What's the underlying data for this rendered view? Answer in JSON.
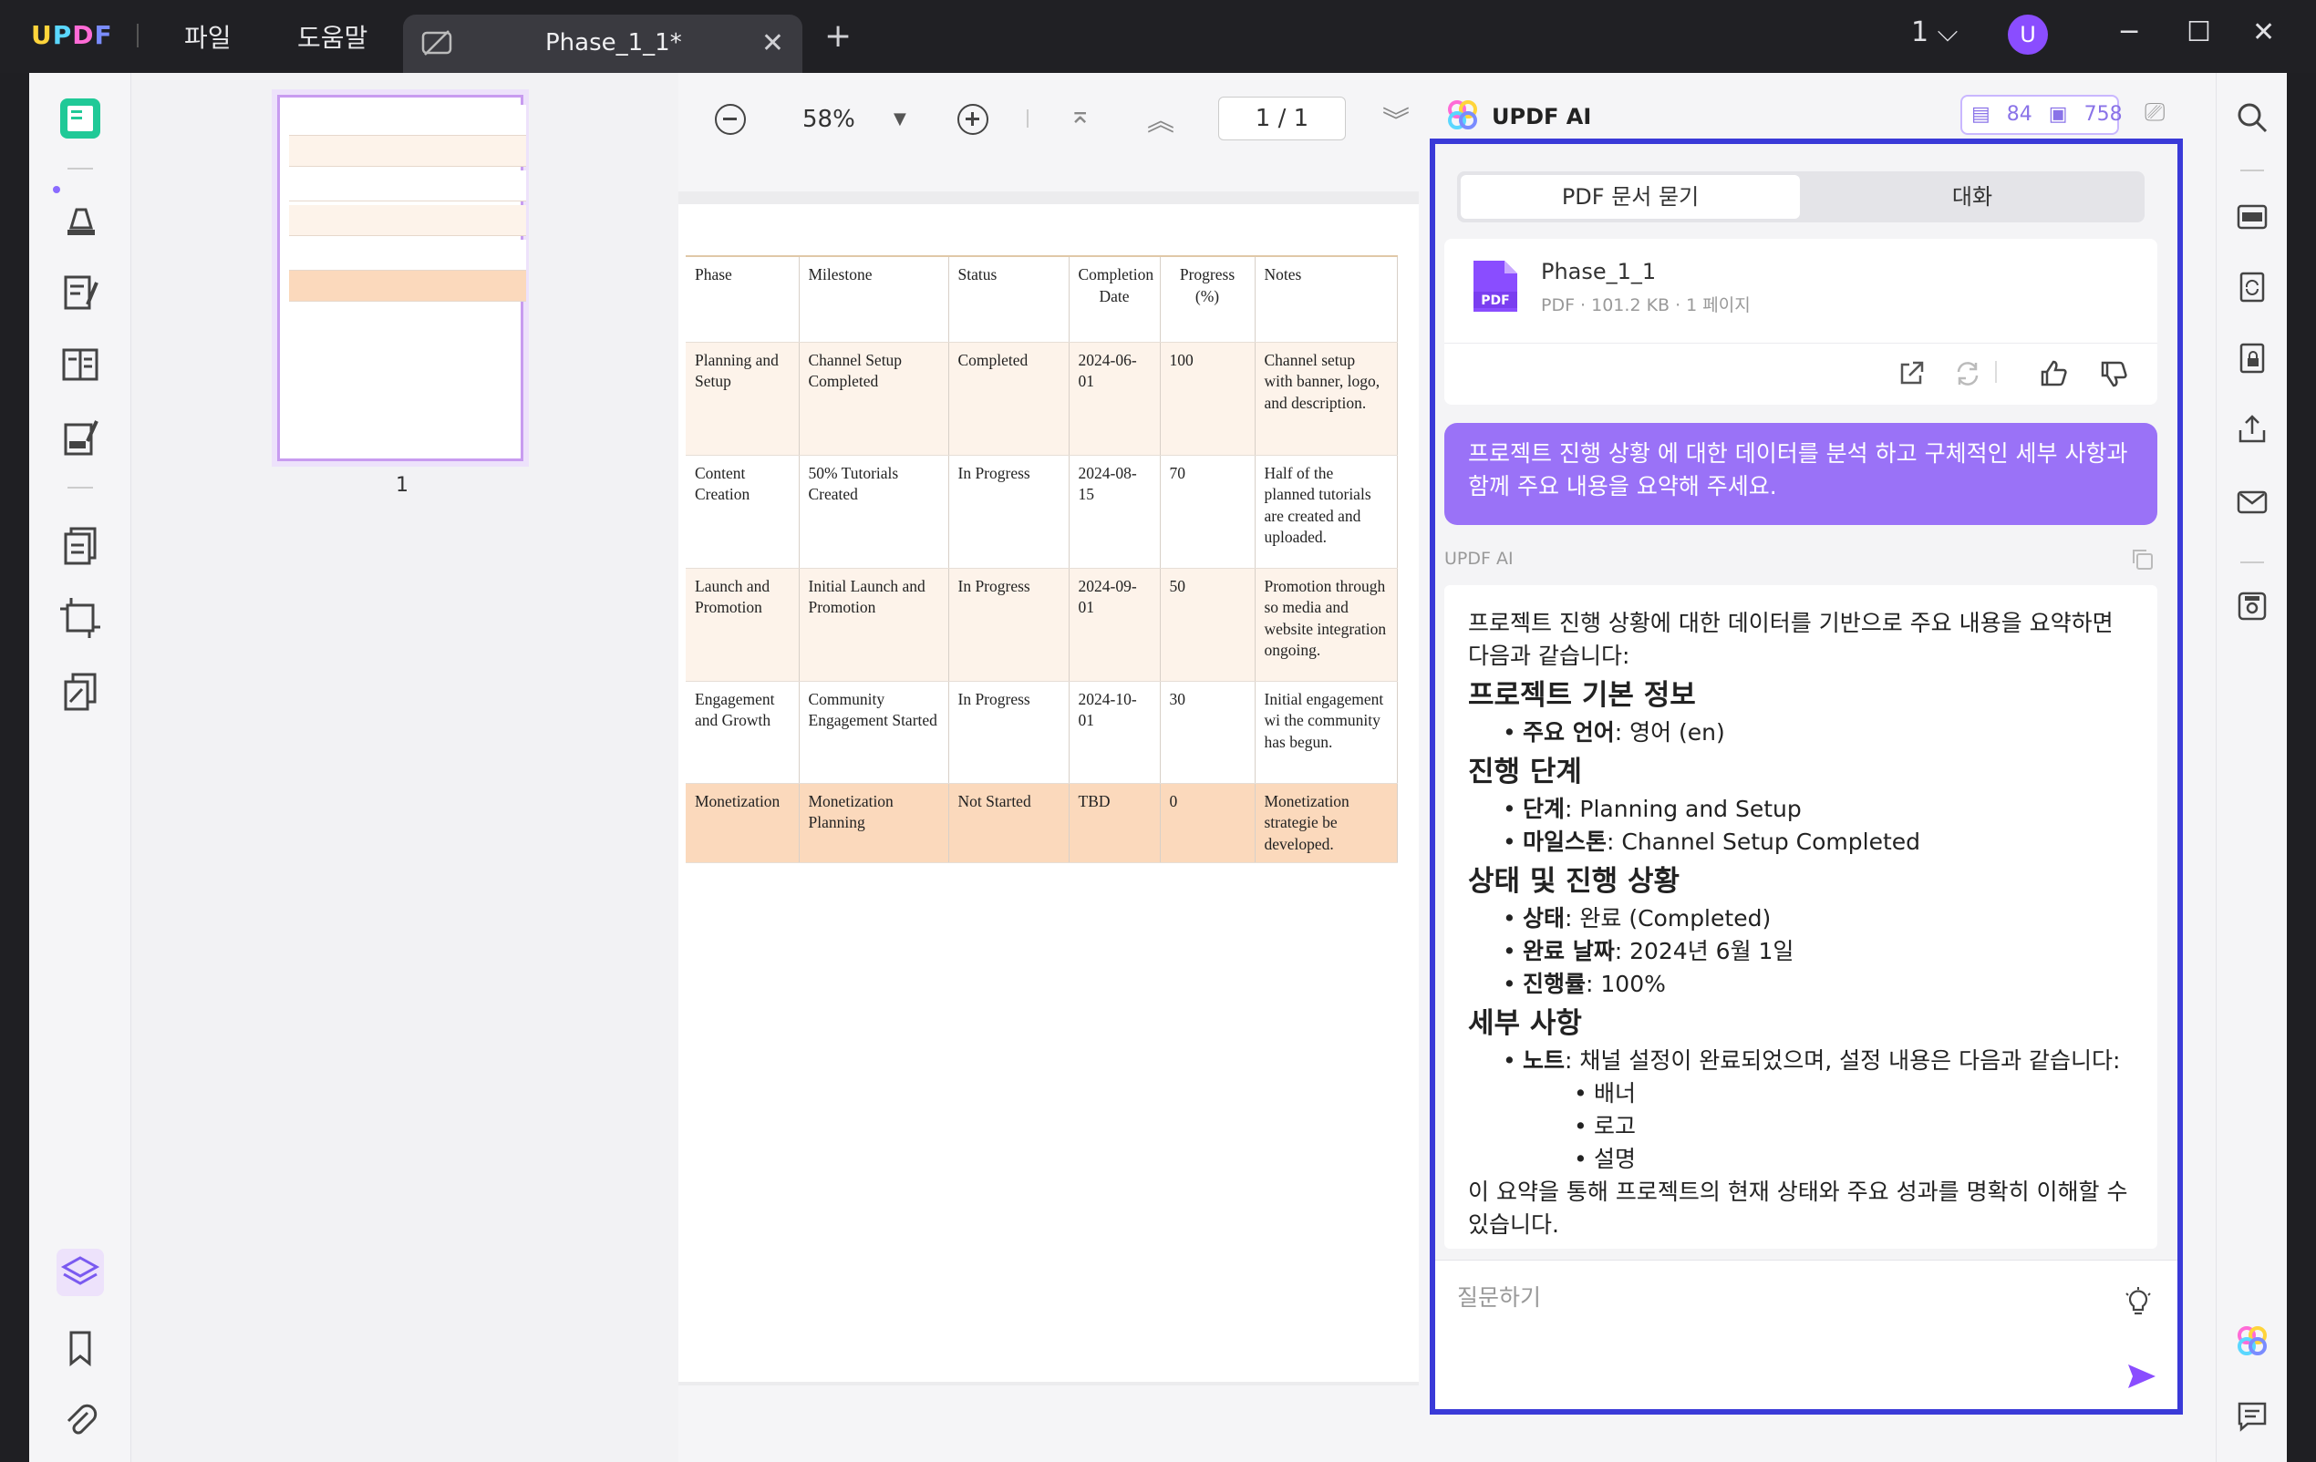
{
  "app": {
    "logo": "UPDF",
    "menu": [
      "파일",
      "도움말"
    ],
    "tab_title": "Phase_1_1*",
    "tab_close": "✕",
    "new_tab": "+",
    "page_indicator": "1",
    "avatar_letter": "U",
    "colors": {
      "accent": "#8a4dff",
      "ai_frame": "#3a3ad8",
      "user_bubble": "#9a72f7",
      "last_row": "#fbd9bc"
    }
  },
  "thumbnail": {
    "label": "1"
  },
  "doc_toolbar": {
    "zoom": "58%",
    "page_current": "1",
    "page_sep": "/",
    "page_total": "1"
  },
  "table": {
    "headers": [
      "Phase",
      "Milestone",
      "Status",
      "Completion Date",
      "Progress (%)",
      "Notes"
    ],
    "rows": [
      [
        "Planning and Setup",
        "Channel Setup Completed",
        "Completed",
        "2024-06-01",
        "100",
        "Channel setup with banner, logo, and description."
      ],
      [
        "Content Creation",
        "50% Tutorials Created",
        "In Progress",
        "2024-08-15",
        "70",
        "Half of the planned tutorials are created and uploaded."
      ],
      [
        "Launch and Promotion",
        "Initial Launch and Promotion",
        "In Progress",
        "2024-09-01",
        "50",
        "Promotion through so media and website integration ongoing."
      ],
      [
        "Engagement and Growth",
        "Community Engagement Started",
        "In Progress",
        "2024-10-01",
        "30",
        "Initial engagement wi the community has begun."
      ],
      [
        "Monetization",
        "Monetization Planning",
        "Not Started",
        "TBD",
        "0",
        "Monetization strategie be developed."
      ]
    ]
  },
  "ai": {
    "title": "UPDF AI",
    "credits_a": "84",
    "credits_b": "758",
    "tab_doc": "PDF 문서 묻기",
    "tab_chat": "대화",
    "file_name": "Phase_1_1",
    "file_meta": "PDF · 101.2 KB · 1 페이지",
    "pdf_badge": "PDF",
    "user_prompt": "프로젝트 진행 상황 에 대한 데이터를 분석 하고 구체적인 세부 사항과 함께 주요 내용을 요약해 주세요.",
    "ai_label": "UPDF AI",
    "answer": {
      "intro": "프로젝트 진행 상황에 대한 데이터를 기반으로 주요 내용을 요약하면 다음과 같습니다:",
      "h1": "프로젝트 기본 정보",
      "lang_k": "주요 언어",
      "lang_v": ": 영어 (en)",
      "h2": "진행 단계",
      "stage_k": "단계",
      "stage_v": ": Planning and Setup",
      "ms_k": "마일스톤",
      "ms_v": ": Channel Setup Completed",
      "h3": "상태 및 진행 상황",
      "status_k": "상태",
      "status_v": ": 완료 (Completed)",
      "date_k": "완료 날짜",
      "date_v": ": 2024년 6월 1일",
      "prog_k": "진행률",
      "prog_v": ": 100%",
      "h4": "세부 사항",
      "note_k": "노트",
      "note_v": ": 채널 설정이 완료되었으며, 설정 내용은 다음과 같습니다:",
      "sub": [
        "배너",
        "로고",
        "설명"
      ],
      "closing": "이 요약을 통해 프로젝트의 현재 상태와 주요 성과를 명확히 이해할 수 있습니다."
    },
    "input_placeholder": "질문하기"
  }
}
